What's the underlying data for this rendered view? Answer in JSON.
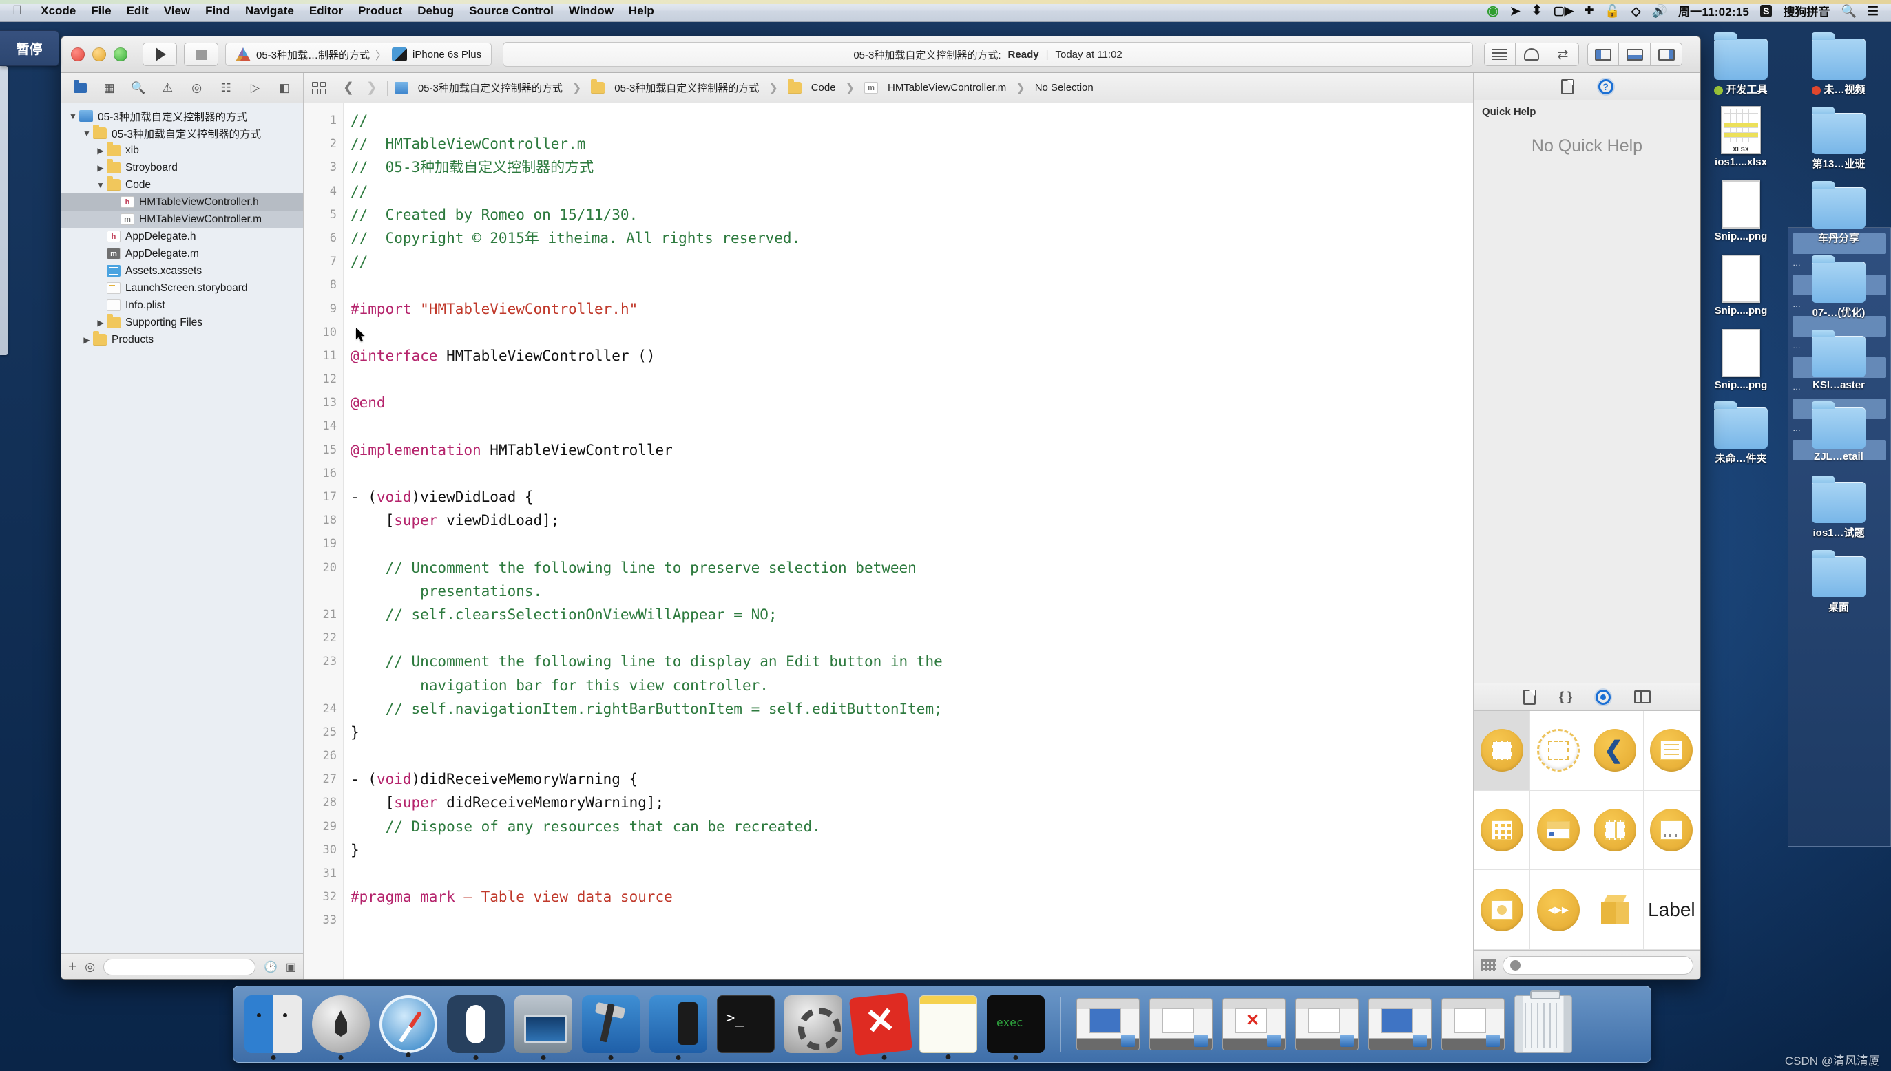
{
  "menubar": {
    "apple": "",
    "items": [
      "Xcode",
      "File",
      "Edit",
      "View",
      "Find",
      "Navigate",
      "Editor",
      "Product",
      "Debug",
      "Source Control",
      "Window",
      "Help"
    ],
    "status": {
      "clock": "周一11:02:15",
      "ime": "S",
      "ime_label": "搜狗拼音",
      "icons": [
        "record-icon",
        "send-icon",
        "bluetooth-icon",
        "screenrecord-icon",
        "airplay-icon",
        "lock-icon",
        "dropbox-icon",
        "volume-icon",
        "search-icon",
        "notification-center-icon"
      ]
    }
  },
  "pause_tab": {
    "label": "暂停"
  },
  "xcode": {
    "toolbar": {
      "run_icon": "play-icon",
      "stop_icon": "stop-icon",
      "scheme_name": "05-3种加载…制器的方式",
      "scheme_sep": "〉",
      "destination": "iPhone 6s Plus",
      "status_title": "05-3种加载自定义控制器的方式:",
      "status_state": "Ready",
      "status_pipe": "|",
      "status_time": "Today at 11:02",
      "editor_modes": [
        "standard-editor-icon",
        "assistant-editor-icon",
        "version-editor-icon"
      ],
      "panel_toggles": [
        "navigator-toggle-icon",
        "debug-area-toggle-icon",
        "utilities-toggle-icon"
      ]
    },
    "navigator": {
      "tabs": [
        "project-navigator-icon",
        "symbol-navigator-icon",
        "find-navigator-icon",
        "issue-navigator-icon",
        "test-navigator-icon",
        "debug-navigator-icon",
        "breakpoint-navigator-icon",
        "report-navigator-icon"
      ],
      "tree": [
        {
          "label": "05-3种加载自定义控制器的方式",
          "indent": 0,
          "twisty": "▼",
          "icon": "project-icon",
          "selected": false
        },
        {
          "label": "05-3种加载自定义控制器的方式",
          "indent": 1,
          "twisty": "▼",
          "icon": "folder-icon",
          "selected": false
        },
        {
          "label": "xib",
          "indent": 2,
          "twisty": "▶",
          "icon": "folder-icon",
          "selected": false
        },
        {
          "label": "Stroyboard",
          "indent": 2,
          "twisty": "▶",
          "icon": "folder-icon",
          "selected": false
        },
        {
          "label": "Code",
          "indent": 2,
          "twisty": "▼",
          "icon": "folder-icon",
          "selected": false
        },
        {
          "label": "HMTableViewController.h",
          "indent": 3,
          "twisty": "",
          "icon": "h-file-icon",
          "selected": true
        },
        {
          "label": "HMTableViewController.m",
          "indent": 3,
          "twisty": "",
          "icon": "m-file-icon",
          "selected": true
        },
        {
          "label": "AppDelegate.h",
          "indent": 2,
          "twisty": "",
          "icon": "h-file-icon",
          "selected": false
        },
        {
          "label": "AppDelegate.m",
          "indent": 2,
          "twisty": "",
          "icon": "m-file-dark-icon",
          "selected": false
        },
        {
          "label": "Assets.xcassets",
          "indent": 2,
          "twisty": "",
          "icon": "assets-icon",
          "selected": false
        },
        {
          "label": "LaunchScreen.storyboard",
          "indent": 2,
          "twisty": "",
          "icon": "storyboard-icon",
          "selected": false
        },
        {
          "label": "Info.plist",
          "indent": 2,
          "twisty": "",
          "icon": "plist-icon",
          "selected": false
        },
        {
          "label": "Supporting Files",
          "indent": 2,
          "twisty": "▶",
          "icon": "folder-icon",
          "selected": false
        },
        {
          "label": "Products",
          "indent": 1,
          "twisty": "▶",
          "icon": "folder-icon",
          "selected": false
        }
      ],
      "bottom": {
        "add": "+",
        "filter_placeholder": ""
      }
    },
    "jumpbar": {
      "crumbs": [
        {
          "label": "05-3种加载自定义控制器的方式",
          "icon": "project-icon"
        },
        {
          "label": "05-3种加载自定义控制器的方式",
          "icon": "folder-icon"
        },
        {
          "label": "Code",
          "icon": "folder-icon"
        },
        {
          "label": "HMTableViewController.m",
          "icon": "m-file-icon"
        },
        {
          "label": "No Selection",
          "icon": ""
        }
      ]
    },
    "editor": {
      "line_numbers": [
        "1",
        "2",
        "3",
        "4",
        "5",
        "6",
        "7",
        "8",
        "9",
        "10",
        "11",
        "12",
        "13",
        "14",
        "15",
        "16",
        "17",
        "18",
        "19",
        "20",
        "",
        "21",
        "22",
        "23",
        "",
        "24",
        "25",
        "26",
        "27",
        "28",
        "29",
        "30",
        "31",
        "32",
        "33"
      ],
      "lines": [
        {
          "n": "1",
          "segs": [
            {
              "t": "//",
              "c": "cm"
            }
          ]
        },
        {
          "n": "2",
          "segs": [
            {
              "t": "//  HMTableViewController.m",
              "c": "cm"
            }
          ]
        },
        {
          "n": "3",
          "segs": [
            {
              "t": "//  05-3种加载自定义控制器的方式",
              "c": "cm"
            }
          ]
        },
        {
          "n": "4",
          "segs": [
            {
              "t": "//",
              "c": "cm"
            }
          ]
        },
        {
          "n": "5",
          "segs": [
            {
              "t": "//  Created by Romeo on 15/11/30.",
              "c": "cm"
            }
          ]
        },
        {
          "n": "6",
          "segs": [
            {
              "t": "//  Copyright © 2015年 itheima. All rights reserved.",
              "c": "cm"
            }
          ]
        },
        {
          "n": "7",
          "segs": [
            {
              "t": "//",
              "c": "cm"
            }
          ]
        },
        {
          "n": "8",
          "segs": [
            {
              "t": "",
              "c": "pl"
            }
          ]
        },
        {
          "n": "9",
          "segs": [
            {
              "t": "#import ",
              "c": "kw"
            },
            {
              "t": "\"HMTableViewController.h\"",
              "c": "st"
            }
          ]
        },
        {
          "n": "10",
          "segs": [
            {
              "t": "",
              "c": "pl"
            }
          ]
        },
        {
          "n": "11",
          "segs": [
            {
              "t": "@interface",
              "c": "kw"
            },
            {
              "t": " HMTableViewController ()",
              "c": "pl"
            }
          ]
        },
        {
          "n": "12",
          "segs": [
            {
              "t": "",
              "c": "pl"
            }
          ]
        },
        {
          "n": "13",
          "segs": [
            {
              "t": "@end",
              "c": "kw"
            }
          ]
        },
        {
          "n": "14",
          "segs": [
            {
              "t": "",
              "c": "pl"
            }
          ]
        },
        {
          "n": "15",
          "segs": [
            {
              "t": "@implementation",
              "c": "kw"
            },
            {
              "t": " HMTableViewController",
              "c": "pl"
            }
          ]
        },
        {
          "n": "16",
          "segs": [
            {
              "t": "",
              "c": "pl"
            }
          ]
        },
        {
          "n": "17",
          "segs": [
            {
              "t": "- (",
              "c": "pl"
            },
            {
              "t": "void",
              "c": "kw"
            },
            {
              "t": ")viewDidLoad {",
              "c": "pl"
            }
          ]
        },
        {
          "n": "18",
          "segs": [
            {
              "t": "    [",
              "c": "pl"
            },
            {
              "t": "super",
              "c": "kw"
            },
            {
              "t": " viewDidLoad];",
              "c": "pl"
            }
          ]
        },
        {
          "n": "19",
          "segs": [
            {
              "t": "",
              "c": "pl"
            }
          ]
        },
        {
          "n": "20",
          "segs": [
            {
              "t": "    // Uncomment the following line to preserve selection between",
              "c": "cm"
            }
          ]
        },
        {
          "n": "",
          "segs": [
            {
              "t": "        presentations.",
              "c": "cm"
            }
          ]
        },
        {
          "n": "21",
          "segs": [
            {
              "t": "    // self.clearsSelectionOnViewWillAppear = NO;",
              "c": "cm"
            }
          ]
        },
        {
          "n": "22",
          "segs": [
            {
              "t": "",
              "c": "pl"
            }
          ]
        },
        {
          "n": "23",
          "segs": [
            {
              "t": "    // Uncomment the following line to display an Edit button in the",
              "c": "cm"
            }
          ]
        },
        {
          "n": "",
          "segs": [
            {
              "t": "        navigation bar for this view controller.",
              "c": "cm"
            }
          ]
        },
        {
          "n": "24",
          "segs": [
            {
              "t": "    // self.navigationItem.rightBarButtonItem = self.editButtonItem;",
              "c": "cm"
            }
          ]
        },
        {
          "n": "25",
          "segs": [
            {
              "t": "}",
              "c": "pl"
            }
          ]
        },
        {
          "n": "26",
          "segs": [
            {
              "t": "",
              "c": "pl"
            }
          ]
        },
        {
          "n": "27",
          "segs": [
            {
              "t": "- (",
              "c": "pl"
            },
            {
              "t": "void",
              "c": "kw"
            },
            {
              "t": ")didReceiveMemoryWarning {",
              "c": "pl"
            }
          ]
        },
        {
          "n": "28",
          "segs": [
            {
              "t": "    [",
              "c": "pl"
            },
            {
              "t": "super",
              "c": "kw"
            },
            {
              "t": " didReceiveMemoryWarning];",
              "c": "pl"
            }
          ]
        },
        {
          "n": "29",
          "segs": [
            {
              "t": "    // Dispose of any resources that can be recreated.",
              "c": "cm"
            }
          ]
        },
        {
          "n": "30",
          "segs": [
            {
              "t": "}",
              "c": "pl"
            }
          ]
        },
        {
          "n": "31",
          "segs": [
            {
              "t": "",
              "c": "pl"
            }
          ]
        },
        {
          "n": "32",
          "segs": [
            {
              "t": "#pragma mark",
              "c": "kw"
            },
            {
              "t": " – Table view data source",
              "c": "st"
            }
          ]
        },
        {
          "n": "33",
          "segs": [
            {
              "t": "",
              "c": "pl"
            }
          ]
        }
      ]
    },
    "utilities": {
      "tabs": [
        "file-inspector-icon",
        "quick-help-inspector-icon"
      ],
      "quick_help": {
        "title": "Quick Help",
        "empty": "No Quick Help"
      },
      "library": {
        "tabs": [
          "file-template-library-icon",
          "code-snippet-library-icon",
          "object-library-icon",
          "media-library-icon"
        ],
        "items": [
          {
            "name": "view-controller-object",
            "kind": "solid-square",
            "selected": true
          },
          {
            "name": "storyboard-reference-object",
            "kind": "dashed-circle",
            "selected": false
          },
          {
            "name": "navigation-controller-object",
            "kind": "back-chevron",
            "selected": false
          },
          {
            "name": "table-view-controller-object",
            "kind": "lines",
            "selected": false
          },
          {
            "name": "collection-view-controller-object",
            "kind": "dots-grid",
            "selected": false
          },
          {
            "name": "tab-bar-controller-object",
            "kind": "navbar",
            "selected": false
          },
          {
            "name": "split-view-controller-object",
            "kind": "split",
            "selected": false
          },
          {
            "name": "page-view-controller-object",
            "kind": "tabbar",
            "selected": false
          },
          {
            "name": "gl-kit-view-controller-object",
            "kind": "imageview",
            "selected": false
          },
          {
            "name": "avkit-player-controller-object",
            "kind": "player",
            "selected": false
          },
          {
            "name": "object-cube",
            "kind": "cube",
            "selected": false
          },
          {
            "name": "label-object",
            "kind": "label",
            "label": "Label",
            "selected": false
          }
        ],
        "filter_placeholder": ""
      }
    }
  },
  "desktop": {
    "icons": [
      {
        "label": "开发工具",
        "type": "folder",
        "dot": "#9ec83a"
      },
      {
        "label": "未…视频",
        "type": "folder",
        "dot": "#e0472d"
      },
      {
        "label": "ios1....xlsx",
        "type": "xlsx"
      },
      {
        "label": "第13…业班",
        "type": "folder"
      },
      {
        "label": "Snip....png",
        "type": "png"
      },
      {
        "label": "车丹分享",
        "type": "folder"
      },
      {
        "label": "Snip....png",
        "type": "png"
      },
      {
        "label": "07-…(优化)",
        "type": "folder"
      },
      {
        "label": "Snip....png",
        "type": "png"
      },
      {
        "label": "KSI…aster",
        "type": "folder"
      },
      {
        "label": "未命…件夹",
        "type": "folder"
      },
      {
        "label": "ZJL…etail",
        "type": "folder"
      },
      {
        "label": "",
        "type": "none"
      },
      {
        "label": "ios1…试题",
        "type": "folder"
      },
      {
        "label": "",
        "type": "none"
      },
      {
        "label": "桌面",
        "type": "folder"
      }
    ]
  },
  "dock": {
    "items": [
      {
        "name": "finder",
        "cls": "dk-finder",
        "running": true
      },
      {
        "name": "launchpad",
        "cls": "dk-launchpad",
        "running": true
      },
      {
        "name": "safari",
        "cls": "dk-safari",
        "running": true
      },
      {
        "name": "mouse-app",
        "cls": "dk-mouse",
        "running": true
      },
      {
        "name": "quicktime-player",
        "cls": "dk-quicktime",
        "running": true
      },
      {
        "name": "xcode",
        "cls": "dk-xcode",
        "running": true
      },
      {
        "name": "simulator",
        "cls": "dk-sim",
        "running": true
      },
      {
        "name": "terminal",
        "cls": "dk-terminal",
        "running": false
      },
      {
        "name": "system-preferences",
        "cls": "dk-prefs",
        "running": false
      },
      {
        "name": "xmind",
        "cls": "dk-xmind",
        "running": true
      },
      {
        "name": "notes",
        "cls": "dk-notes",
        "running": true
      },
      {
        "name": "exec-app",
        "cls": "dk-exec",
        "running": true
      }
    ],
    "minimized_count": 6,
    "trash": "trash-icon"
  },
  "watermark": "CSDN @清风清厦"
}
